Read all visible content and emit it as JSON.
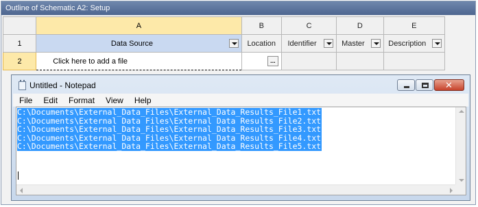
{
  "window": {
    "title": "Outline of Schematic A2: Setup"
  },
  "grid": {
    "columns": [
      {
        "letter": "A",
        "label": "Data Source"
      },
      {
        "letter": "B",
        "label": "Location"
      },
      {
        "letter": "C",
        "label": "Identifier"
      },
      {
        "letter": "D",
        "label": "Master"
      },
      {
        "letter": "E",
        "label": "Description"
      }
    ],
    "rows": [
      {
        "number": "1"
      },
      {
        "number": "2",
        "placeholder": "Click here to add a file",
        "browse": "..."
      }
    ]
  },
  "notepad": {
    "title": "Untitled - Notepad",
    "menu": [
      "File",
      "Edit",
      "Format",
      "View",
      "Help"
    ],
    "lines": [
      "C:\\Documents\\External_Data_Files\\External_Data_Results_File1.txt",
      "C:\\Documents\\External_Data_Files\\External_Data_Results_File2.txt",
      "C:\\Documents\\External_Data_Files\\External_Data_Results_File3.txt",
      "C:\\Documents\\External_Data_Files\\External_Data_Results_File4.txt",
      "C:\\Documents\\External_Data_Files\\External_Data_Results_File5.txt"
    ],
    "selection_color": "#3399ff",
    "icons": [
      "notepad-icon",
      "minimize-icon",
      "maximize-icon",
      "close-icon"
    ]
  }
}
